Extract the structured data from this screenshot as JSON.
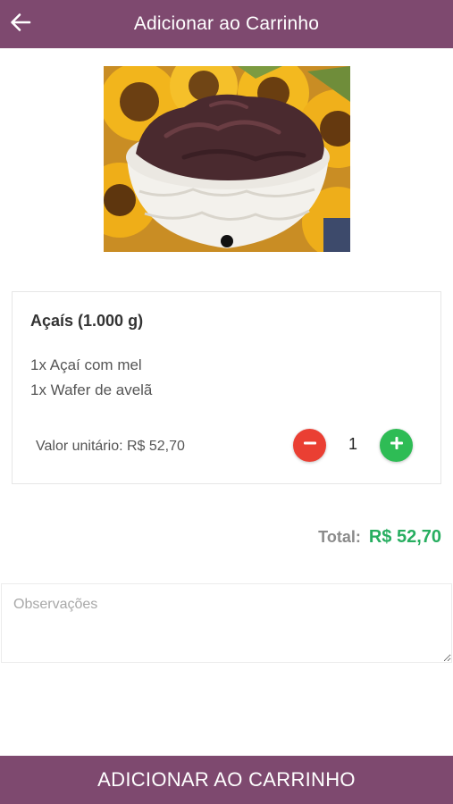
{
  "header": {
    "title": "Adicionar ao Carrinho",
    "back_icon": "arrow-left-icon",
    "background": "#7e496f"
  },
  "product_image": {
    "carousel_count": 1,
    "active_index": 0
  },
  "item": {
    "name": "Açaís (1.000 g)",
    "addons": [
      "1x Açaí com mel",
      "1x Wafer de avelã"
    ],
    "unit_price_label": "Valor unitário: R$ 52,70",
    "quantity": "1",
    "minus_icon": "minus-icon",
    "plus_icon": "plus-icon",
    "minus_color": "#ea3f33",
    "plus_color": "#2ebc55"
  },
  "total": {
    "label": "Total:",
    "value": "R$ 52,70",
    "value_color": "#27ae60"
  },
  "notes": {
    "placeholder": "Observações",
    "value": ""
  },
  "footer": {
    "button_label": "ADICIONAR AO CARRINHO",
    "background": "#7e496f"
  }
}
